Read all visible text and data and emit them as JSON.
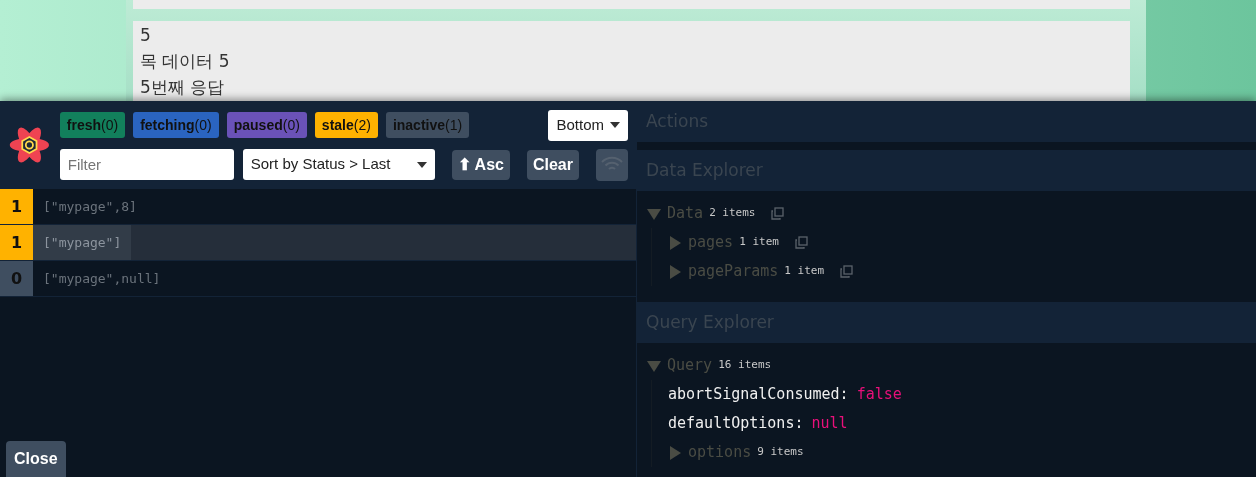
{
  "page": {
    "cards": [
      {
        "lines": [
          "5",
          "목 데이터 5",
          "5번째 응답"
        ]
      }
    ]
  },
  "devtools": {
    "status_badges": [
      {
        "label": "fresh",
        "count": "(0)",
        "color": "#12805c"
      },
      {
        "label": "fetching",
        "count": "(0)",
        "color": "#2a64c0"
      },
      {
        "label": "paused",
        "count": "(0)",
        "color": "#6a52b8"
      },
      {
        "label": "stale",
        "count": "(2)",
        "color": "#ffb200"
      },
      {
        "label": "inactive",
        "count": "(1)",
        "color": "#3f4e60"
      }
    ],
    "position_select": "Bottom",
    "filter": {
      "placeholder": "Filter"
    },
    "sort_select": "Sort by Status > Last",
    "sort_button": "⬆ Asc",
    "clear_button": "Clear",
    "queries": [
      {
        "observers": "1",
        "color": "#ffb200",
        "key": "[\"mypage\",8]",
        "selected": false
      },
      {
        "observers": "1",
        "color": "#ffb200",
        "key": "[\"mypage\"]",
        "selected": true
      },
      {
        "observers": "0",
        "color": "#3f4e60",
        "key": "[\"mypage\",null]",
        "selected": false
      }
    ],
    "close_button": "Close",
    "panels": [
      {
        "title": "Actions"
      },
      {
        "title": "Data Explorer",
        "tree": {
          "kind": "node",
          "label": "Data",
          "meta": "2 items",
          "expanded": true,
          "copyable": true,
          "children": [
            {
              "kind": "node",
              "label": "pages",
              "meta": "1 item",
              "expanded": false,
              "copyable": true
            },
            {
              "kind": "node",
              "label": "pageParams",
              "meta": "1 item",
              "expanded": false,
              "copyable": true
            }
          ]
        }
      },
      {
        "title": "Query Explorer",
        "tree": {
          "kind": "node",
          "label": "Query",
          "meta": "16 items",
          "expanded": true,
          "copyable": false,
          "children": [
            {
              "kind": "value",
              "key": "abortSignalConsumed:",
              "value": "false"
            },
            {
              "kind": "value",
              "key": "defaultOptions:",
              "value": "null"
            },
            {
              "kind": "node",
              "label": "options",
              "meta": "9 items",
              "expanded": false,
              "copyable": false
            }
          ]
        }
      }
    ]
  }
}
